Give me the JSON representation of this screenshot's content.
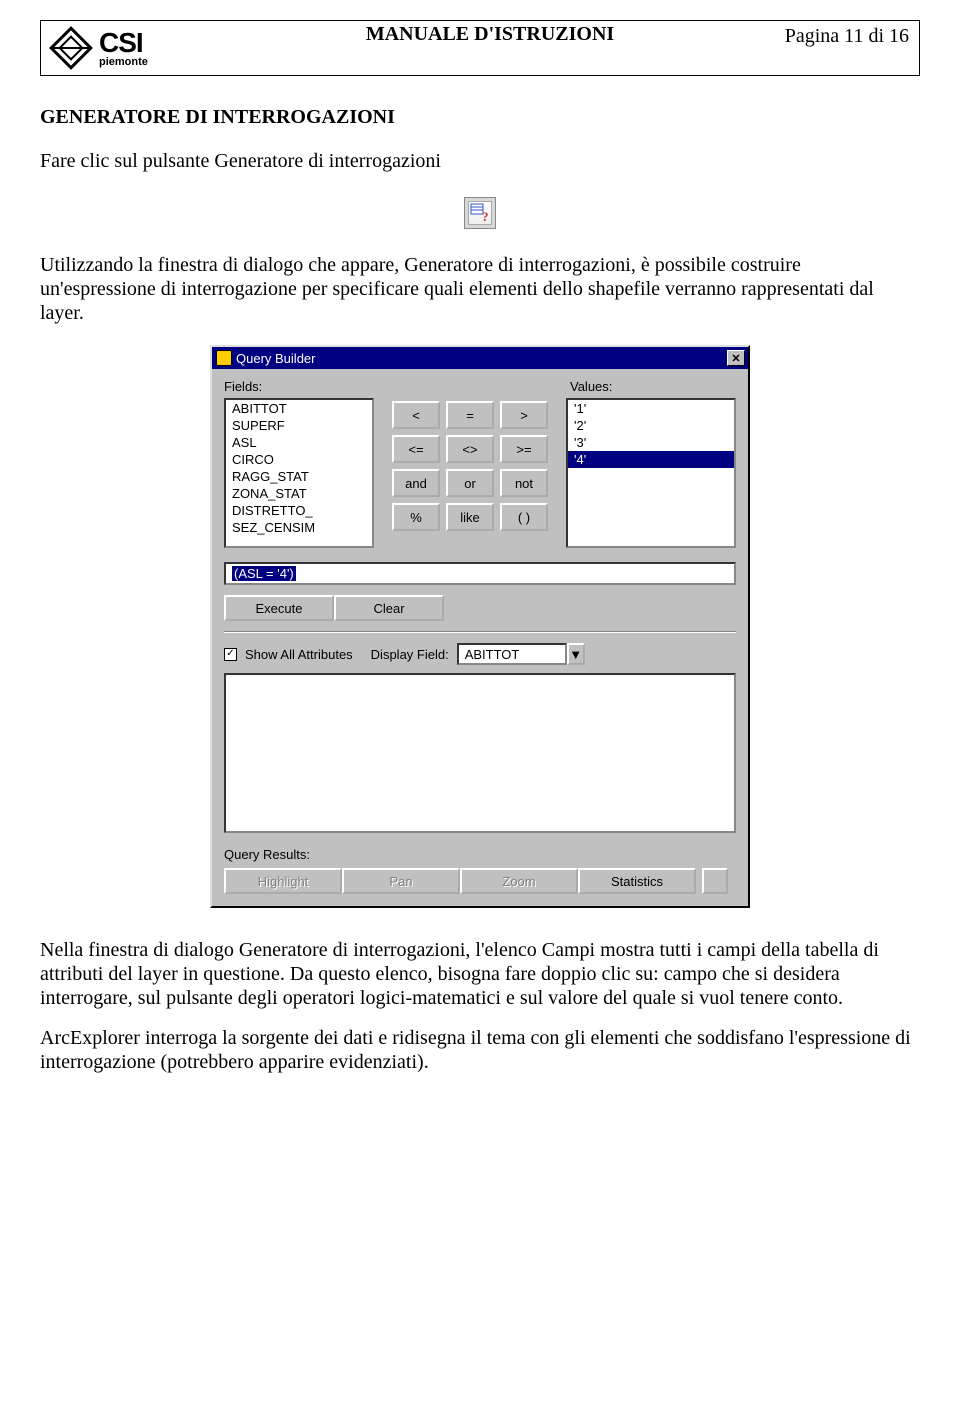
{
  "header": {
    "logo_top": "CSI",
    "logo_bottom": "piemonte",
    "title": "MANUALE D'ISTRUZIONI",
    "page_label": "Pagina 11 di 16"
  },
  "section_heading": "GENERATORE DI INTERROGAZIONI",
  "intro_line": "Fare clic sul pulsante Generatore di interrogazioni",
  "para1": "Utilizzando la finestra di dialogo che appare, Generatore di interrogazioni, è possibile costruire un'espressione di interrogazione per specificare quali elementi dello shapefile verranno rappresentati dal layer.",
  "para2": "Nella finestra di dialogo Generatore di interrogazioni, l'elenco Campi mostra tutti i campi della tabella di attributi del layer in questione. Da questo elenco, bisogna fare doppio clic su: campo che si desidera interrogare, sul pulsante degli operatori logici-matematici e sul valore del quale si vuol tenere conto.",
  "para3": "ArcExplorer interroga la sorgente dei dati e ridisegna il tema con gli elementi che soddisfano l'espressione di interrogazione (potrebbero apparire evidenziati).",
  "toolbar_icon_name": "query-builder-icon",
  "query_builder": {
    "title": "Query Builder",
    "fields_label": "Fields:",
    "values_label": "Values:",
    "fields": [
      "ABITTOT",
      "SUPERF",
      "ASL",
      "CIRCO",
      "RAGG_STAT",
      "ZONA_STAT",
      "DISTRETTO_",
      "SEZ_CENSIM"
    ],
    "values": [
      "'1'",
      "'2'",
      "'3'",
      "'4'"
    ],
    "value_selected_index": 3,
    "operators": [
      "<",
      "=",
      ">",
      "<=",
      "<>",
      ">=",
      "and",
      "or",
      "not",
      "%",
      "like",
      "( )"
    ],
    "expression": "(ASL = '4')",
    "execute_label": "Execute",
    "clear_label": "Clear",
    "show_all_label": "Show All Attributes",
    "show_all_checked": "✓",
    "display_field_label": "Display Field:",
    "display_field_value": "ABITTOT",
    "results_label": "Query Results:",
    "bottom_buttons": {
      "highlight": "Highlight",
      "pan": "Pan",
      "zoom": "Zoom",
      "statistics": "Statistics"
    }
  }
}
